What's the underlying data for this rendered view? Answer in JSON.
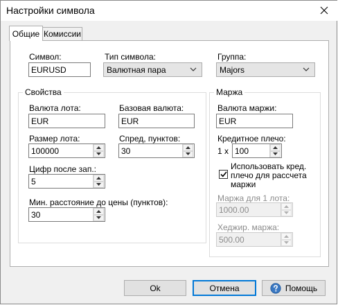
{
  "window": {
    "title": "Настройки символа",
    "close_glyph": "✕"
  },
  "tabs": [
    {
      "label": "Общие",
      "active": true
    },
    {
      "label": "Комиссии",
      "active": false
    }
  ],
  "symbol": {
    "label": "Символ:",
    "value": "EURUSD"
  },
  "symbol_type": {
    "label": "Тип символа:",
    "value": "Валютная пара"
  },
  "group_field": {
    "label": "Группа:",
    "value": "Majors"
  },
  "properties": {
    "legend": "Свойства",
    "lot_currency": {
      "label": "Валюта лота:",
      "value": "EUR"
    },
    "base_currency": {
      "label": "Базовая валюта:",
      "value": "EUR"
    },
    "lot_size": {
      "label": "Размер лота:",
      "value": "100000"
    },
    "spread": {
      "label": "Спред, пунктов:",
      "value": "30"
    },
    "digits": {
      "label": "Цифр после зап.:",
      "value": "5"
    },
    "min_distance": {
      "label": "Мин. расстояние до цены (пунктов):",
      "value": "30"
    }
  },
  "margin": {
    "legend": "Маржа",
    "currency": {
      "label": "Валюта маржи:",
      "value": "EUR"
    },
    "leverage": {
      "label": "Кредитное плечо:",
      "prefix": "1 x",
      "value": "100"
    },
    "use_credit": {
      "label_line1": "Использовать кред.",
      "label_line2": "плечо для рассчета",
      "label_line3": "маржи",
      "checked": true
    },
    "per_lot": {
      "label": "Маржа для 1 лота:",
      "value": "1000.00"
    },
    "hedged": {
      "label": "Хеджир. маржа:",
      "value": "500.00"
    }
  },
  "buttons": {
    "ok": "Ok",
    "cancel": "Отмена",
    "help": "Помощь"
  },
  "colors": {
    "accent": "#0078d7",
    "help_icon": "#3a78c2"
  },
  "icons": [
    "close-icon",
    "chevron-down-icon",
    "spin-up-icon",
    "spin-down-icon",
    "checkmark-icon",
    "help-icon"
  ]
}
